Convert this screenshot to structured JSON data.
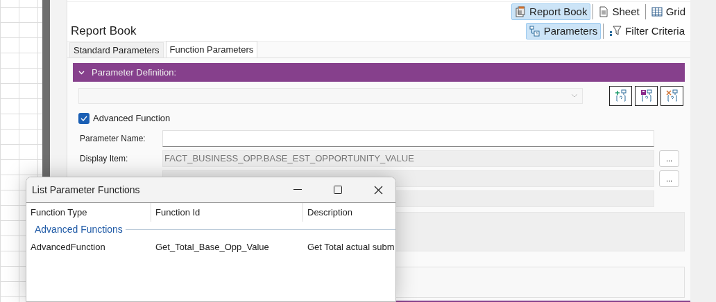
{
  "view_toolbar": [
    {
      "label": "Report Book",
      "kind": "book",
      "selected": true
    },
    {
      "label": "Sheet",
      "kind": "sheet",
      "selected": false
    },
    {
      "label": "Grid",
      "kind": "grid",
      "selected": false
    }
  ],
  "title": "Report Book",
  "mode_toolbar": [
    {
      "label": "Parameters",
      "kind": "params",
      "selected": true
    },
    {
      "label": "Filter Criteria",
      "kind": "filter",
      "selected": false
    }
  ],
  "tabs": [
    {
      "label": "Standard Parameters",
      "selected": false
    },
    {
      "label": "Function Parameters",
      "selected": true
    }
  ],
  "section": {
    "title": "Parameter Definition:",
    "expanded": true
  },
  "action_buttons": [
    {
      "kind": "add"
    },
    {
      "kind": "save"
    },
    {
      "kind": "delete"
    }
  ],
  "advanced_function": {
    "label": "Advanced Function",
    "checked": true
  },
  "fields": [
    {
      "label": "Parameter Name:",
      "kind": "editable"
    },
    {
      "label": "Display Item:",
      "value": "FACT_BUSINESS_OPP.BASE_EST_OPPORTUNITY_VALUE",
      "kind": "readonly",
      "browse": "..."
    },
    {
      "kind": "readonly",
      "browse": "..."
    },
    {
      "kind": "readonly"
    }
  ],
  "dialog": {
    "title": "List Parameter Functions",
    "columns": [
      "Function Type",
      "Function Id",
      "Description"
    ],
    "groups": [
      {
        "title": "Advanced Functions",
        "rows": [
          {
            "cells": [
              "AdvancedFunction",
              "Get_Total_Base_Opp_Value",
              "Get Total actual subm"
            ]
          }
        ]
      }
    ]
  }
}
